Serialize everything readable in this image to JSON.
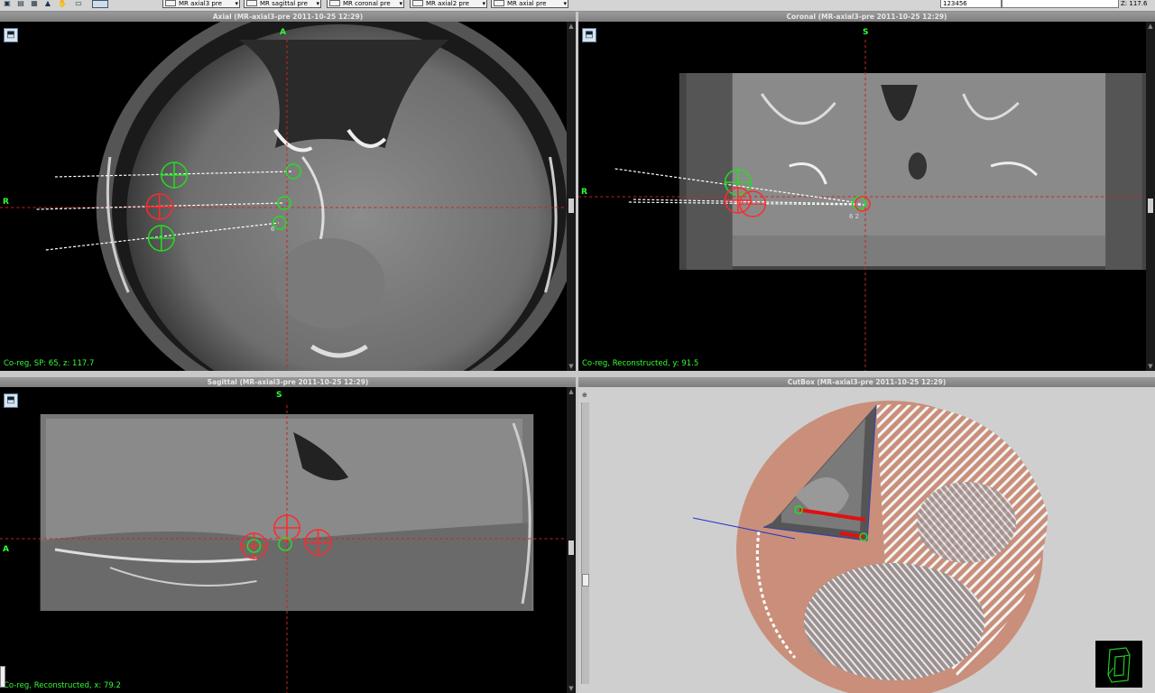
{
  "toolbar": {
    "icons": [
      "layout-icon",
      "db-icon",
      "grid-icon",
      "pointer-icon",
      "hand-icon",
      "screen-icon"
    ],
    "series": [
      {
        "label": "MR axial3 pre"
      },
      {
        "label": "MR sagittal pre"
      },
      {
        "label": "MR coronal pre"
      },
      {
        "label": "MR axial2 pre"
      },
      {
        "label": "MR axial pre"
      }
    ],
    "field_value": "123456",
    "coord_readout": "Z: 117.6"
  },
  "viewports": {
    "axial": {
      "title": "Axial (MR-axial3-pre 2011-10-25 12:29)",
      "top_label": "A",
      "left_label": "R",
      "status": "Co-reg, SP: 65, z: 117.7",
      "marker_number": "6"
    },
    "coronal": {
      "title": "Coronal (MR-axial3-pre 2011-10-25 12:29)",
      "top_label": "S",
      "left_label": "R",
      "status": "Co-reg, Reconstructed, y: 91.5",
      "marker_number": "6 2"
    },
    "sagittal": {
      "title": "Sagittal (MR-axial3-pre 2011-10-25 12:29)",
      "top_label": "S",
      "left_label": "A",
      "status": "Co-reg, Reconstructed, x: 79.2"
    },
    "cutbox": {
      "title": "CutBox (MR-axial3-pre 2011-10-25 12:29)"
    }
  },
  "colors": {
    "overlay_text": "#33ff33",
    "crosshair": "#cc2222",
    "target_marker": "#ff2a2a",
    "entry_marker": "#22dd22",
    "skin_surface": "#c98f7a"
  }
}
